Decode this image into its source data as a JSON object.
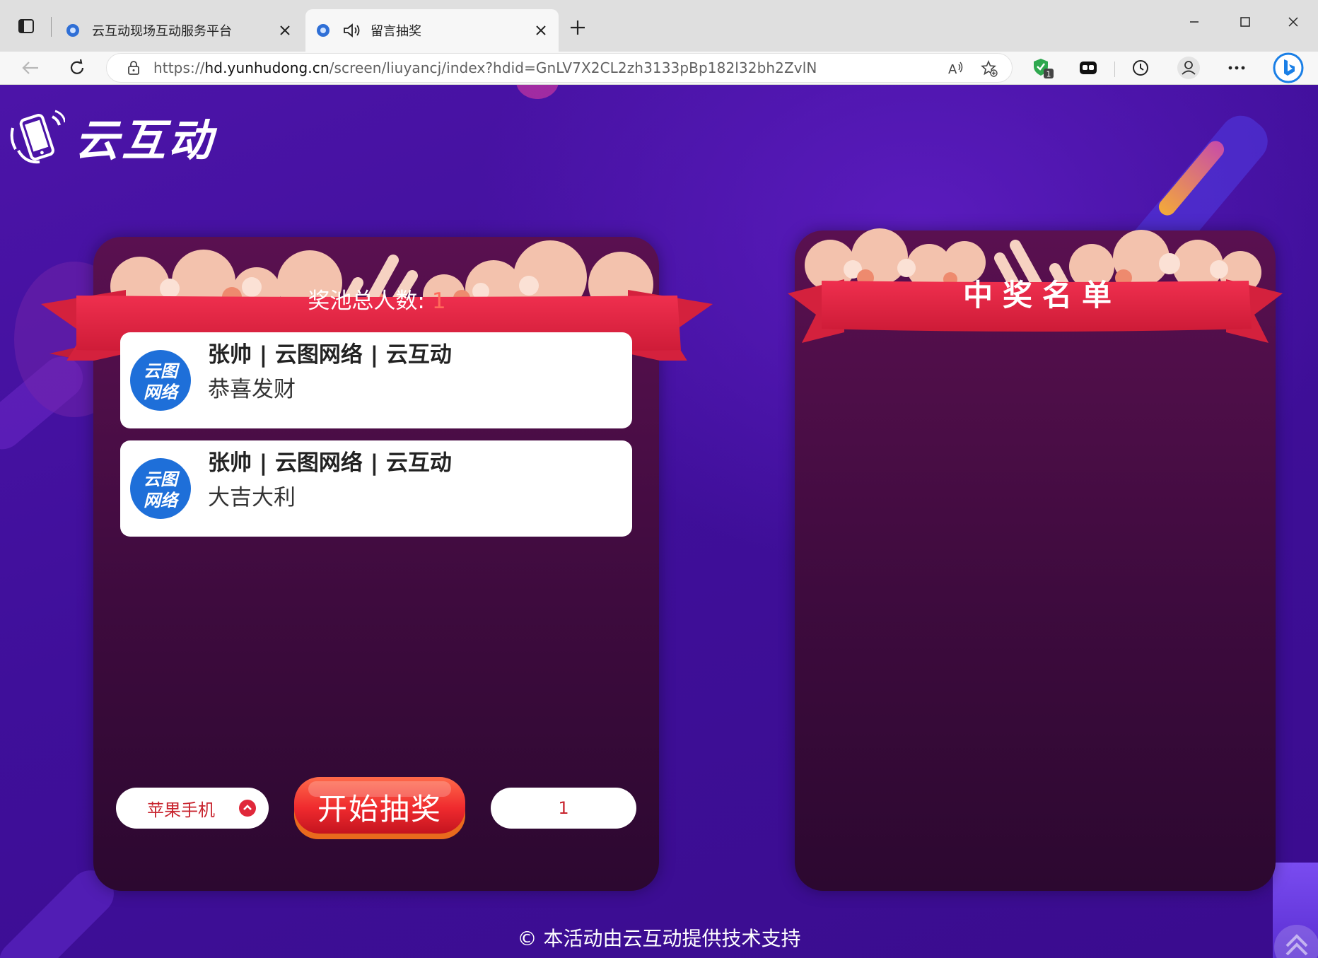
{
  "browser": {
    "tabs": [
      {
        "title": "云互动现场互动服务平台",
        "active": false
      },
      {
        "title": "留言抽奖",
        "active": true,
        "audio": true
      }
    ],
    "url_prefix": "https://",
    "url_host": "hd.yunhudong.cn",
    "url_path": "/screen/liuyancj/index?hdid=GnLV7X2CL2zh3133pBp182l32bh2ZvlN",
    "extension_badge": "1",
    "icons": [
      "sidebar-icon",
      "tab-favicon",
      "speaker-icon",
      "close-icon",
      "new-tab-icon",
      "back-icon",
      "refresh-icon",
      "lock-icon",
      "read-aloud-icon",
      "favorite-add-icon",
      "shield-extension-icon",
      "game-extension-icon",
      "history-icon",
      "profile-icon",
      "more-icon",
      "bing-icon",
      "minimize-icon",
      "maximize-icon"
    ]
  },
  "page": {
    "logo_text": "云互动",
    "pool_label": "奖池总人数:",
    "pool_count": "1",
    "winners_title": "中奖名单",
    "messages": [
      {
        "name": "张帅 | 云图网络 | 云互动",
        "content": "恭喜发财",
        "avatar_text_top": "云图",
        "avatar_text_bottom": "网络"
      },
      {
        "name": "张帅 | 云图网络 | 云互动",
        "content": "大吉大利",
        "avatar_text_top": "云图",
        "avatar_text_bottom": "网络"
      }
    ],
    "prize_select": "苹果手机",
    "start_button": "开始抽奖",
    "draw_count": "1",
    "footer": "© 本活动由云互动提供技术支持"
  },
  "colors": {
    "background": "#3f0f9a",
    "panel": "#4a0d45",
    "ribbon": "#e8253f",
    "accent_red": "#c8242e",
    "pool_count": "#ff6b5a",
    "avatar_blue": "#1e6fd9"
  }
}
